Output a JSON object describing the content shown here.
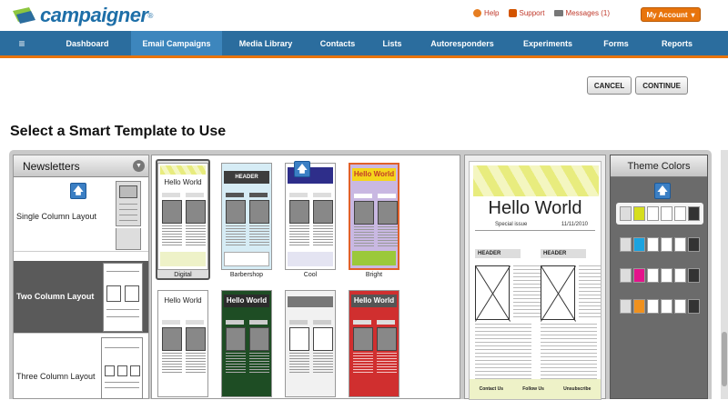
{
  "app": {
    "logo_text": "campaigner",
    "logo_reg": "®"
  },
  "utilities": {
    "help": "Help",
    "support": "Support",
    "messages": "Messages (1)",
    "account": "My Account",
    "account_caret": "▾"
  },
  "nav": {
    "menu_icon": "≡",
    "items": [
      {
        "label": "Dashboard",
        "active": false
      },
      {
        "label": "Email Campaigns",
        "active": true
      },
      {
        "label": "Media Library",
        "active": false
      },
      {
        "label": "Contacts",
        "active": false
      },
      {
        "label": "Lists",
        "active": false
      },
      {
        "label": "Autoresponders",
        "active": false
      },
      {
        "label": "Experiments",
        "active": false
      },
      {
        "label": "Forms",
        "active": false
      },
      {
        "label": "Reports",
        "active": false
      }
    ]
  },
  "actions": {
    "cancel": "CANCEL",
    "continue": "CONTINUE"
  },
  "page": {
    "title": "Select a Smart Template to Use"
  },
  "category": {
    "selected": "Newsletters",
    "dropdown_icon": "▼",
    "layouts": [
      {
        "label": "Single Column Layout",
        "selected": false
      },
      {
        "label": "Two Column Layout",
        "selected": true
      },
      {
        "label": "Three Column Layout",
        "selected": false
      }
    ],
    "up_icon": "🡅"
  },
  "templates": [
    {
      "name": "Digital",
      "banner_text": "Hello World",
      "selected": true,
      "accent": "#e8ec7e",
      "bg": "#ffffff"
    },
    {
      "name": "Barbershop",
      "banner_text": "HEADER",
      "selected": false,
      "accent": "#3d3d3d",
      "bg": "#d6ecf5"
    },
    {
      "name": "Cool",
      "banner_text": "",
      "selected": false,
      "accent": "#2e2e8a",
      "bg": "#ffffff"
    },
    {
      "name": "Bright",
      "banner_text": "Hello World",
      "selected": false,
      "accent": "#f5d51b",
      "bg": "#c9b8e2"
    },
    {
      "name": "",
      "banner_text": "Hello World",
      "selected": false,
      "accent": "#ffffff",
      "bg": "#ffffff"
    },
    {
      "name": "",
      "banner_text": "Hello World",
      "selected": false,
      "accent": "#2c2c2c",
      "bg": "#1e4d24"
    },
    {
      "name": "",
      "banner_text": "",
      "selected": false,
      "accent": "#777777",
      "bg": "#f1f1f1"
    },
    {
      "name": "",
      "banner_text": "Hello World",
      "selected": false,
      "accent": "#555555",
      "bg": "#d02f2f"
    }
  ],
  "preview": {
    "title": "Hello World",
    "special": "Special issue",
    "date": "11/11/2010",
    "header_left": "HEADER",
    "header_right": "HEADER",
    "footer": [
      "Contact Us",
      "Follow Us",
      "Unsubscribe"
    ]
  },
  "theme": {
    "title": "Theme Colors",
    "rows": [
      {
        "selected": true,
        "colors": [
          "#dddddd",
          "#d6de1e",
          "#ffffff",
          "#ffffff",
          "#ffffff",
          "#333333"
        ]
      },
      {
        "selected": false,
        "colors": [
          "#dddddd",
          "#1ba3e0",
          "#ffffff",
          "#ffffff",
          "#ffffff",
          "#333333"
        ]
      },
      {
        "selected": false,
        "colors": [
          "#dddddd",
          "#e4138b",
          "#ffffff",
          "#ffffff",
          "#ffffff",
          "#333333"
        ]
      },
      {
        "selected": false,
        "colors": [
          "#dddddd",
          "#f0911e",
          "#ffffff",
          "#ffffff",
          "#ffffff",
          "#333333"
        ]
      }
    ]
  }
}
